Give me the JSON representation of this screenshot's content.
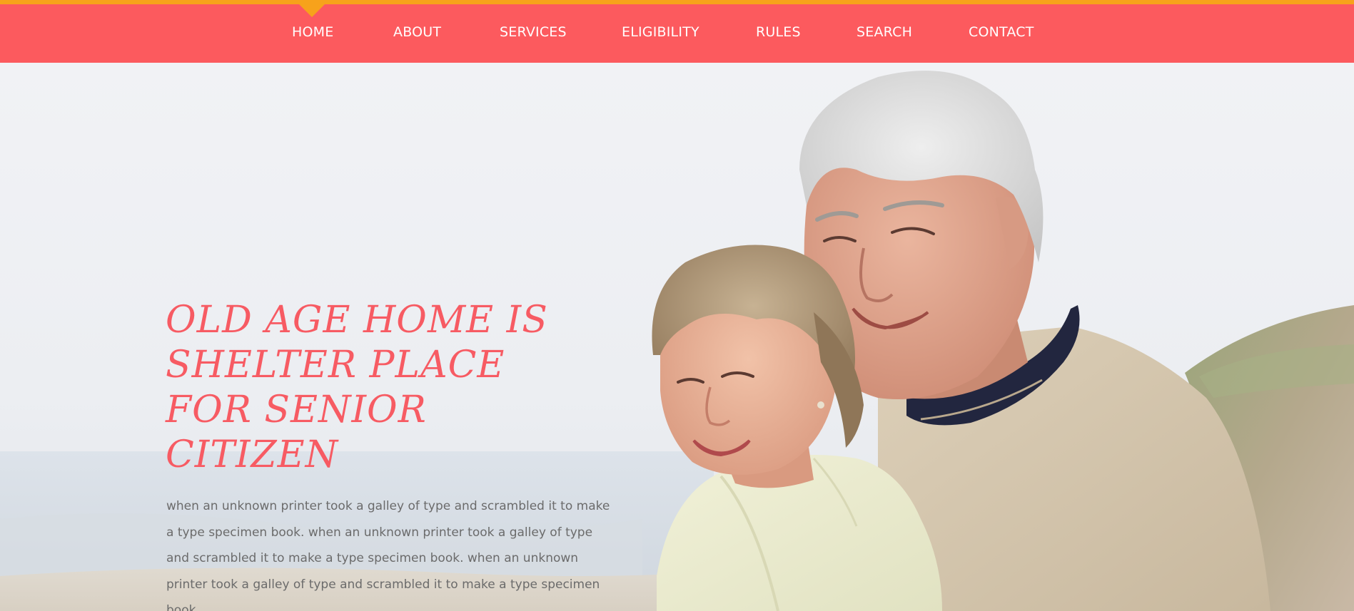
{
  "header": {
    "accent_color": "#f7a21b",
    "bar_color": "#fc5a5e",
    "active_item": "HOME",
    "nav_items": [
      {
        "label": "HOME"
      },
      {
        "label": "ABOUT"
      },
      {
        "label": "SERVICES"
      },
      {
        "label": "ELIGIBILITY"
      },
      {
        "label": "RULES"
      },
      {
        "label": "SEARCH"
      },
      {
        "label": "CONTACT"
      }
    ]
  },
  "hero": {
    "title": "OLD AGE HOME IS SHELTER PLACE FOR SENIOR CITIZEN",
    "title_color": "#f75b63",
    "description": "when an unknown printer took a galley of type and scrambled it to make a type specimen book. when an unknown printer took a galley of type and scrambled it to make a type specimen book. when an unknown printer took a galley of type and scrambled it to make a type specimen book.",
    "image": "photo-of-smiling-senior-couple-on-beach"
  }
}
